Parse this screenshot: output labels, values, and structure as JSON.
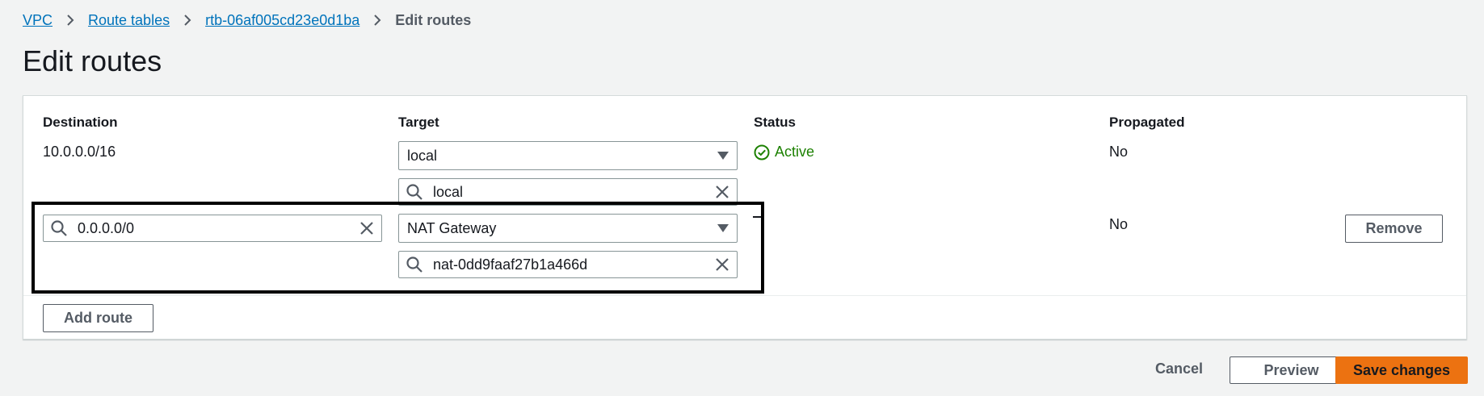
{
  "breadcrumb": {
    "items": [
      "VPC",
      "Route tables",
      "rtb-06af005cd23e0d1ba"
    ],
    "current": "Edit routes"
  },
  "page": {
    "title": "Edit routes"
  },
  "table": {
    "headers": {
      "destination": "Destination",
      "target": "Target",
      "status": "Status",
      "propagated": "Propagated"
    },
    "rows": [
      {
        "destination": "10.0.0.0/16",
        "target_type": "local",
        "target_value": "local",
        "status": "Active",
        "propagated": "No"
      },
      {
        "destination": "0.0.0.0/0",
        "target_type": "NAT Gateway",
        "target_value": "nat-0dd9faaf27b1a466d",
        "status": "–",
        "propagated": "No",
        "remove_label": "Remove"
      }
    ]
  },
  "actions": {
    "add_route": "Add route",
    "cancel": "Cancel",
    "preview": "Preview",
    "save": "Save changes"
  },
  "colors": {
    "link": "#0073bb",
    "success": "#1d8102",
    "primary": "#ec7211",
    "page_bg": "#f2f3f3"
  },
  "icons": [
    "chevron-right-icon",
    "caret-down-icon",
    "search-icon",
    "clear-icon",
    "check-circle-icon"
  ]
}
